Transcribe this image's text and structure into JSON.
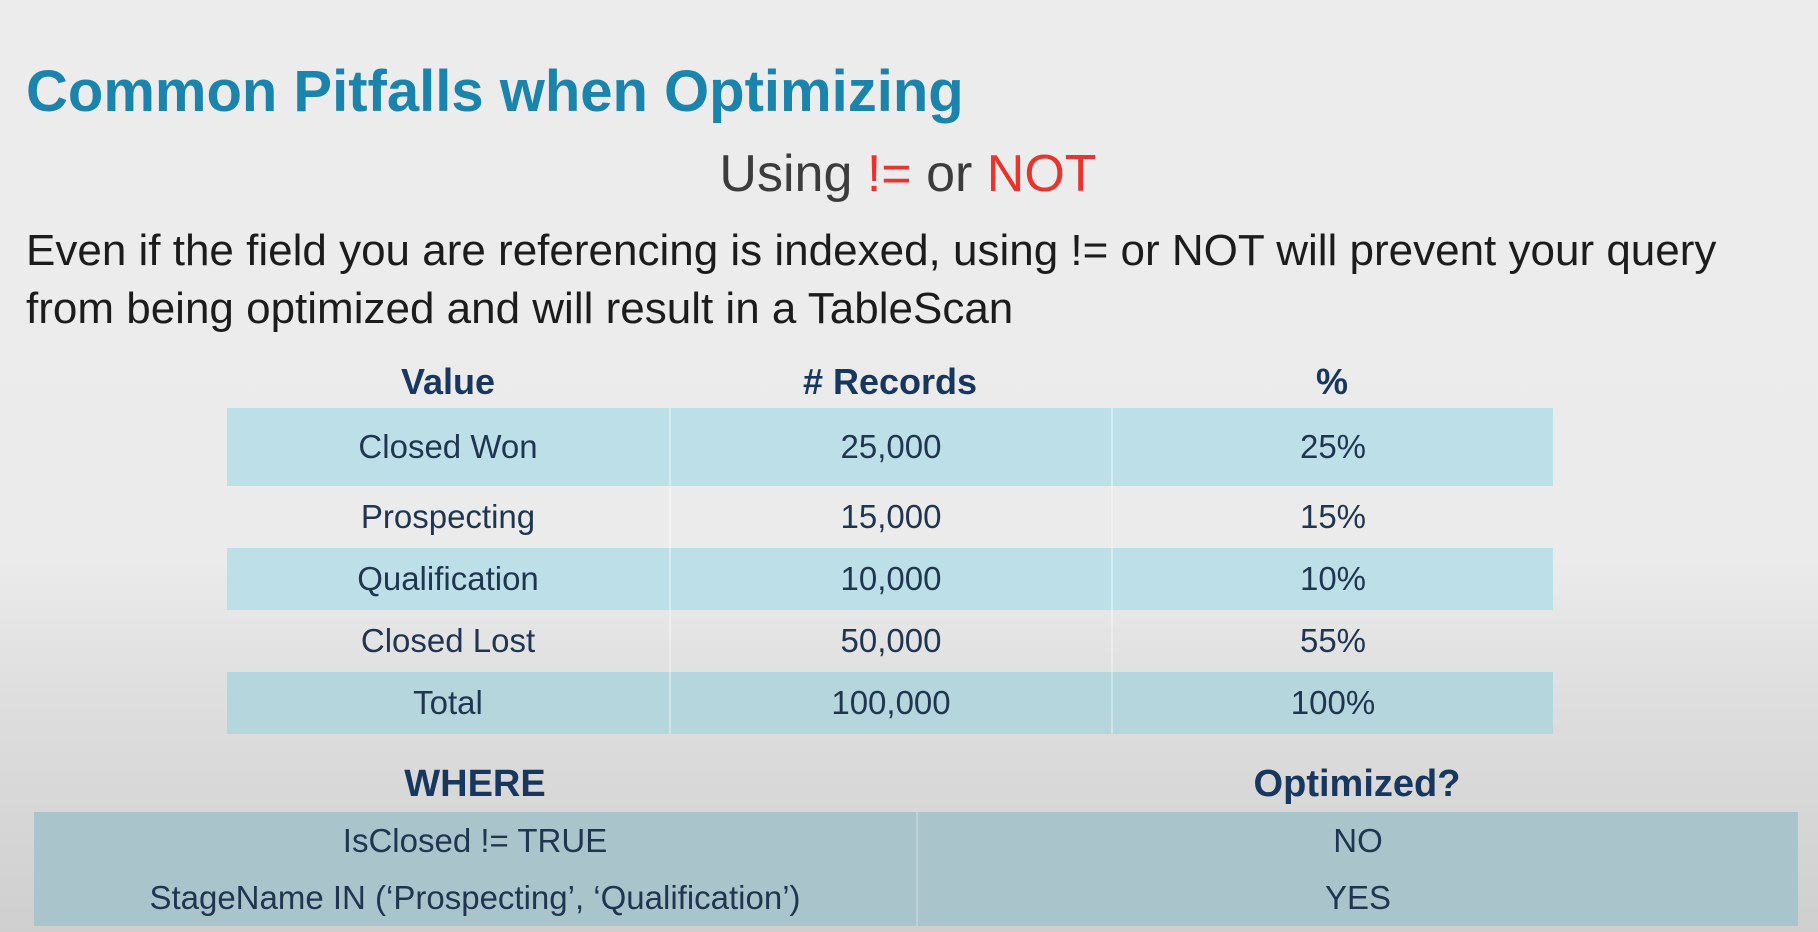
{
  "slide": {
    "title": "Common Pitfalls when Optimizing",
    "subtitle": {
      "part1": "Using ",
      "part2": "!=",
      "part3": " or ",
      "part4": "NOT"
    },
    "body": "Even if the field you are referencing is indexed, using != or NOT will prevent your query from being optimized and will result in a TableScan"
  },
  "stats_table": {
    "headers": [
      "Value",
      "# Records",
      "%"
    ],
    "rows": [
      [
        "Closed Won",
        "25,000",
        "25%"
      ],
      [
        "Prospecting",
        "15,000",
        "15%"
      ],
      [
        "Qualification",
        "10,000",
        "10%"
      ],
      [
        "Closed Lost",
        "50,000",
        "55%"
      ],
      [
        "Total",
        "100,000",
        "100%"
      ]
    ]
  },
  "where_table": {
    "headers": [
      "WHERE",
      "Optimized?"
    ],
    "rows": [
      [
        "IsClosed != TRUE",
        "NO"
      ],
      [
        "StageName IN (‘Prospecting’, ‘Qualification’)",
        "YES"
      ]
    ]
  },
  "colors": {
    "title": "#1a84ad",
    "accent_red": "#e8342c",
    "table_band": "#bde0e8",
    "where_band": "#a9c4cb",
    "header_text": "#17375e"
  }
}
